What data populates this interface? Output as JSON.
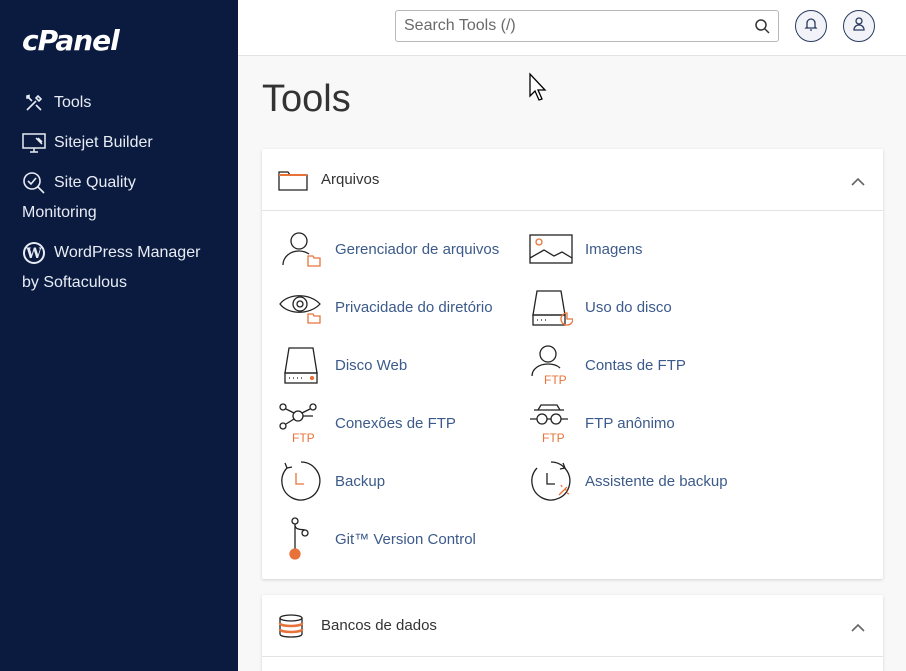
{
  "app": {
    "logo": "cPanel"
  },
  "sidebar": {
    "items": [
      {
        "label": "Tools",
        "icon": "tools-icon"
      },
      {
        "label": "Sitejet Builder",
        "icon": "monitor-icon"
      },
      {
        "label": "Site Quality",
        "label2": "Monitoring",
        "icon": "magnifier-icon"
      },
      {
        "label": "WordPress Manager",
        "label2": "by Softaculous",
        "icon": "wordpress-icon"
      }
    ]
  },
  "header": {
    "search_placeholder": "Search Tools (/)",
    "search_value": "",
    "icons": [
      "search-icon",
      "bell-icon",
      "user-icon"
    ]
  },
  "main": {
    "title": "Tools",
    "sections": [
      {
        "title": "Arquivos",
        "icon": "folder-icon",
        "tools": [
          {
            "label": "Gerenciador de arquivos",
            "icon": "file-manager-icon"
          },
          {
            "label": "Imagens",
            "icon": "images-icon"
          },
          {
            "label": "Privacidade do diretório",
            "icon": "directory-privacy-icon"
          },
          {
            "label": "Uso do disco",
            "icon": "disk-usage-icon"
          },
          {
            "label": "Disco Web",
            "icon": "web-disk-icon"
          },
          {
            "label": "Contas de FTP",
            "icon": "ftp-accounts-icon"
          },
          {
            "label": "Conexões de FTP",
            "icon": "ftp-connections-icon"
          },
          {
            "label": "FTP anônimo",
            "icon": "anonymous-ftp-icon"
          },
          {
            "label": "Backup",
            "icon": "backup-icon"
          },
          {
            "label": "Assistente de backup",
            "icon": "backup-wizard-icon"
          },
          {
            "label": "Git™ Version Control",
            "icon": "git-icon"
          }
        ]
      },
      {
        "title": "Bancos de dados",
        "icon": "database-icon"
      }
    ]
  },
  "colors": {
    "sidebar_bg": "#0b1b3f",
    "accent_orange": "#e8733a",
    "link_blue": "#3c5a8a"
  }
}
